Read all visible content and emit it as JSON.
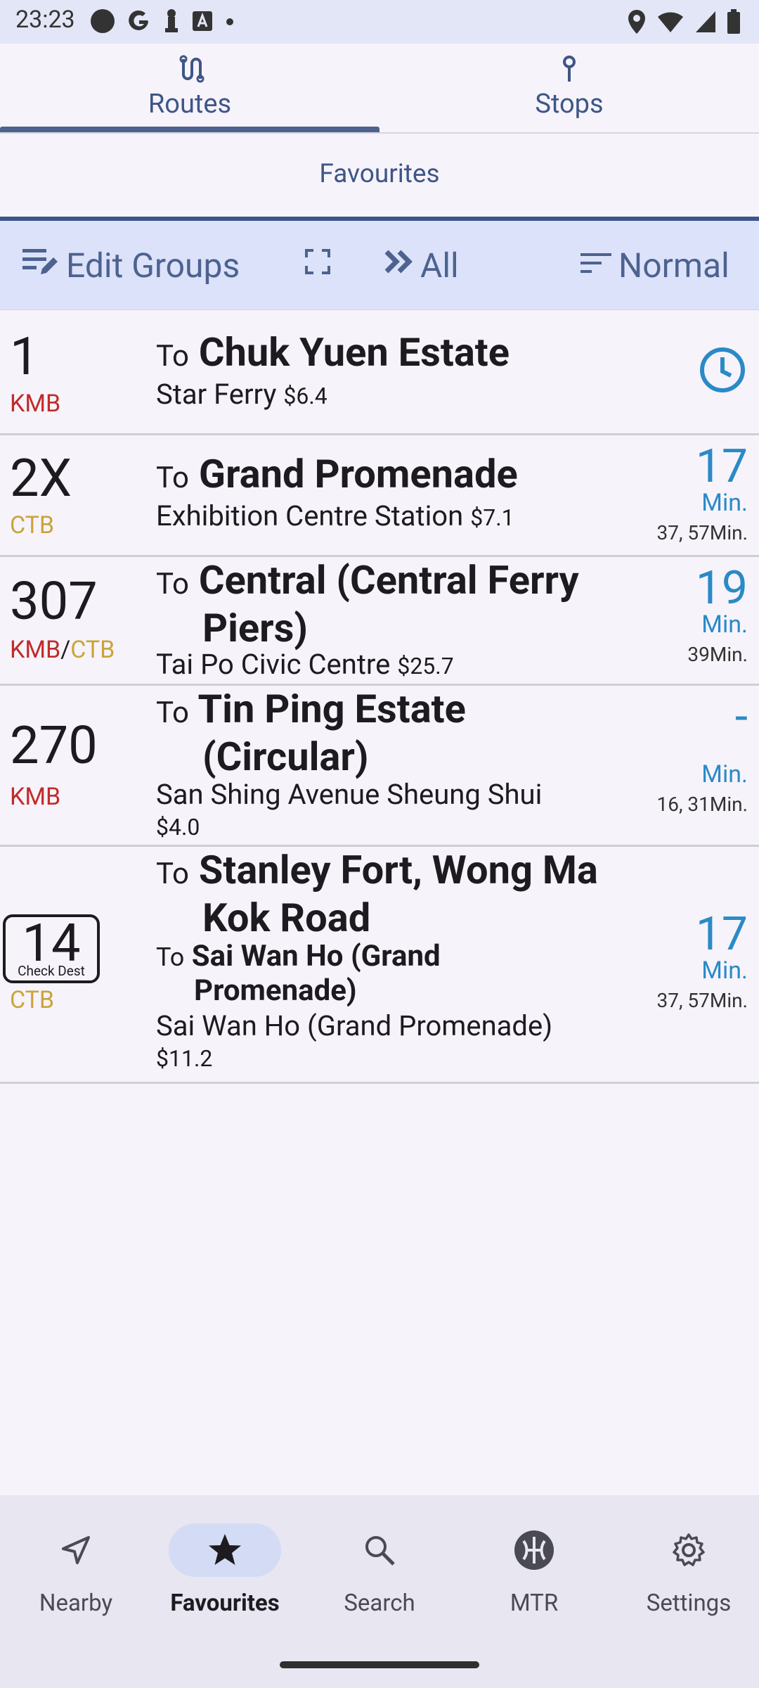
{
  "status_bar": {
    "time": "23:23"
  },
  "tabs": [
    {
      "label": "Routes",
      "icon": "route-icon",
      "active": true
    },
    {
      "label": "Stops",
      "icon": "stop-pin-icon",
      "active": false
    }
  ],
  "group": {
    "label": "Favourites"
  },
  "toolbar": {
    "edit_groups": "Edit Groups",
    "all": "All",
    "sort": "Normal"
  },
  "routes": [
    {
      "number": "1",
      "operators": [
        "KMB"
      ],
      "to": "To",
      "destination": "Chuk Yuen Estate",
      "stop": "Star Ferry",
      "fare": "$6.4",
      "eta": {
        "type": "clock-icon"
      }
    },
    {
      "number": "2X",
      "operators": [
        "CTB"
      ],
      "to": "To",
      "destination": "Grand Promenade",
      "stop": "Exhibition Centre Station",
      "fare": "$7.1",
      "eta": {
        "value": "17",
        "unit": "Min.",
        "next": "37, 57Min."
      }
    },
    {
      "number": "307",
      "operators": [
        "KMB",
        "CTB"
      ],
      "separator": "/",
      "to": "To",
      "destination_line1": "Central (Central Ferry",
      "destination_line2": "Piers)",
      "stop": "Tai Po Civic Centre",
      "fare": "$25.7",
      "eta": {
        "value": "19",
        "unit": "Min.",
        "next": "39Min."
      }
    },
    {
      "number": "270",
      "operators": [
        "KMB"
      ],
      "to": "To",
      "destination_line1": "Tin Ping Estate",
      "destination_line2": "(Circular)",
      "stop": "San Shing Avenue Sheung Shui",
      "fare": "$4.0",
      "eta": {
        "value": "-",
        "unit": "Min.",
        "next": "16, 31Min."
      }
    },
    {
      "number": "14",
      "badge": "Check Dest",
      "operators": [
        "CTB"
      ],
      "to": "To",
      "destination_line1": "Stanley Fort, Wong Ma",
      "destination_line2": "Kok Road",
      "sub_to": "To",
      "sub_destination_line1": "Sai Wan Ho (Grand",
      "sub_destination_line2": "Promenade)",
      "stop": "Sai Wan Ho (Grand Promenade)",
      "fare": "$11.2",
      "eta": {
        "value": "17",
        "unit": "Min.",
        "next": "37, 57Min."
      }
    }
  ],
  "bottom_nav": [
    {
      "label": "Nearby",
      "icon": "navigation-arrow-icon",
      "active": false
    },
    {
      "label": "Favourites",
      "icon": "star-icon",
      "active": true
    },
    {
      "label": "Search",
      "icon": "search-icon",
      "active": false
    },
    {
      "label": "MTR",
      "icon": "mtr-logo-icon",
      "active": false
    },
    {
      "label": "Settings",
      "icon": "gear-icon",
      "active": false
    }
  ],
  "colors": {
    "accent": "#4d628f",
    "kmb": "#c12b2b",
    "ctb": "#c9a43a",
    "eta": "#2a8ac6"
  }
}
